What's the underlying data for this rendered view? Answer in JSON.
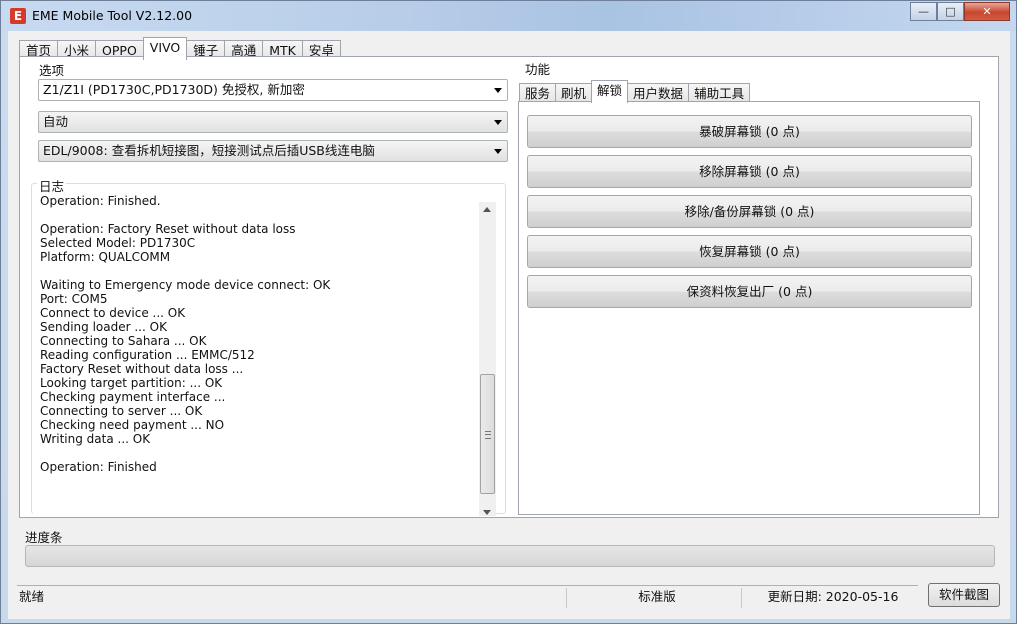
{
  "window": {
    "title": "EME Mobile Tool V2.12.00",
    "icon_letter": "E",
    "min": "—",
    "max": "□",
    "close": "✕"
  },
  "top_tabs": [
    "首页",
    "小米",
    "OPPO",
    "VIVO",
    "锤子",
    "高通",
    "MTK",
    "安卓"
  ],
  "active_top_tab": "VIVO",
  "options": {
    "label": "选项",
    "model": "Z1/Z1I (PD1730C,PD1730D) 免授权, 新加密",
    "mode": "自动",
    "edl": "EDL/9008: 查看拆机短接图，短接测试点后插USB线连电脑"
  },
  "log": {
    "label": "日志",
    "lines": [
      "Operation: Finished.",
      "",
      "Operation: Factory Reset without data loss",
      "Selected Model: PD1730C",
      "Platform: QUALCOMM",
      "",
      "Waiting to Emergency mode device connect: OK",
      "Port: COM5",
      "Connect to device ... OK",
      "Sending loader ... OK",
      "Connecting to Sahara ... OK",
      "Reading configuration ... EMMC/512",
      "Factory Reset without data loss ...",
      "Looking target partition: ... OK",
      "Checking payment interface ...",
      "Connecting to server ... OK",
      "Checking need payment ... NO",
      "Writing data ... OK",
      "",
      "Operation: Finished"
    ]
  },
  "functions": {
    "label": "功能",
    "tabs": [
      "服务",
      "刷机",
      "解锁",
      "用户数据",
      "辅助工具"
    ],
    "active_tab": "解锁",
    "buttons": [
      "暴破屏幕锁 (0 点)",
      "移除屏幕锁 (0 点)",
      "移除/备份屏幕锁 (0 点)",
      "恢复屏幕锁 (0 点)",
      "保资料恢复出厂 (0 点)"
    ]
  },
  "progress": {
    "label": "进度条",
    "value": 0
  },
  "status": {
    "state": "就绪",
    "edition": "标准版",
    "update_date": "更新日期: 2020-05-16",
    "screenshot_button": "软件截图"
  }
}
